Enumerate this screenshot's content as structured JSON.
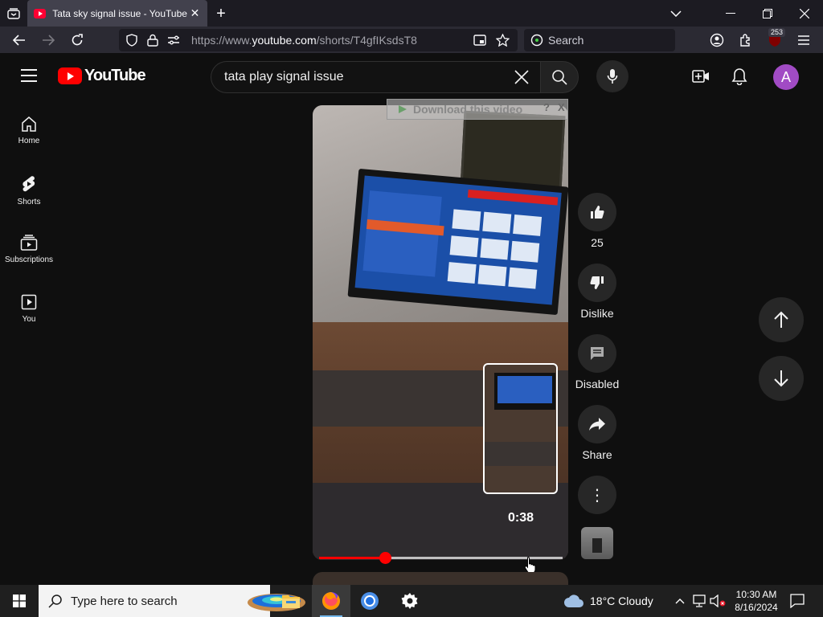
{
  "browser": {
    "tab_title": "Tata sky signal issue - YouTube",
    "url_prefix": "https://www.",
    "url_domain": "youtube.com",
    "url_path": "/shorts/T4gfIKsdsT8",
    "search_placeholder": "Search",
    "extension_badge": "253"
  },
  "youtube": {
    "logo_text": "YouTube",
    "search_query": "tata play signal issue",
    "avatar_letter": "A",
    "sidebar": [
      {
        "label": "Home",
        "icon": "home-icon"
      },
      {
        "label": "Shorts",
        "icon": "shorts-icon"
      },
      {
        "label": "Subscriptions",
        "icon": "subscriptions-icon"
      },
      {
        "label": "You",
        "icon": "you-icon"
      }
    ],
    "overlay": {
      "download_text": "Download this video",
      "help": "?",
      "close": "X"
    },
    "actions": {
      "like_count": "25",
      "dislike_label": "Dislike",
      "comments_label": "Disabled",
      "share_label": "Share",
      "more_label": "⋮"
    },
    "preview_time": "0:38",
    "progress_fraction": 0.27
  },
  "taskbar": {
    "search_text": "Type here to search",
    "weather": "18°C  Cloudy",
    "time": "10:30 AM",
    "date": "8/16/2024"
  }
}
